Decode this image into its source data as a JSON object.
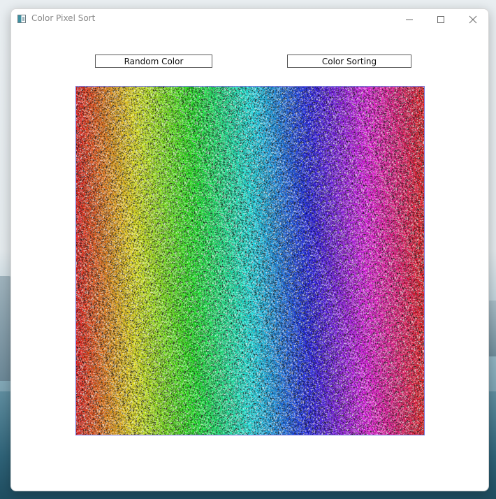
{
  "window": {
    "title": "Color Pixel Sort",
    "controls": {
      "minimize_icon": "minimize-icon",
      "maximize_icon": "maximize-icon",
      "close_icon": "close-icon"
    }
  },
  "toolbar": {
    "random_label": "Random Color",
    "sort_label": "Color Sorting"
  },
  "canvas": {
    "content": "pixel hue spectrum sorted left to right (red → yellow → green → cyan → blue → magenta → red) with scattered noise pixels",
    "sorted": true
  },
  "colors": {
    "window_bg": "#ffffff",
    "button_border": "#5a5a5a",
    "canvas_border": "#7a7ae0",
    "title_text": "#8a8a8a"
  }
}
